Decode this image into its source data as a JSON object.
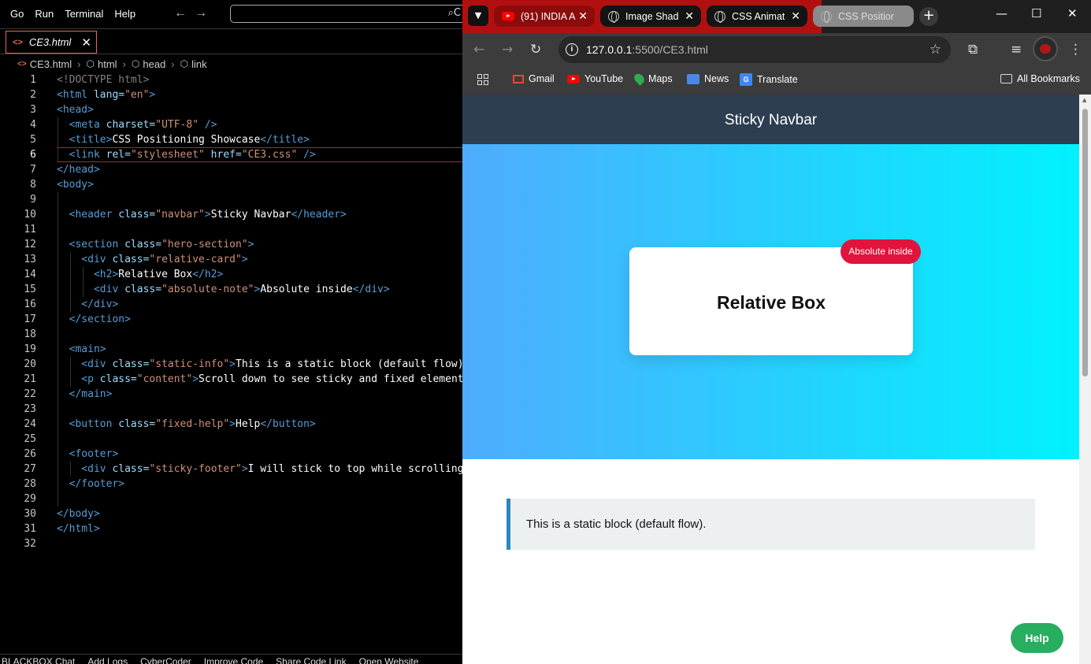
{
  "editor": {
    "menu": [
      "Go",
      "Run",
      "Terminal",
      "Help"
    ],
    "command_center_text": "C",
    "tab": {
      "name": "CE3.html",
      "icon": "html-file-icon"
    },
    "breadcrumb": [
      "CE3.html",
      "html",
      "head",
      "link"
    ],
    "current_line": 6,
    "lines": [
      "1",
      "2",
      "3",
      "4",
      "5",
      "6",
      "7",
      "8",
      "9",
      "10",
      "11",
      "12",
      "13",
      "14",
      "15",
      "16",
      "17",
      "18",
      "19",
      "20",
      "21",
      "22",
      "23",
      "24",
      "25",
      "26",
      "27",
      "28",
      "29",
      "30",
      "31",
      "32"
    ],
    "code": {
      "l1": "<!DOCTYPE html>",
      "l2a": "<html",
      "l2b": " lang=",
      "l2c": "\"en\"",
      "l2d": ">",
      "l3": "<head>",
      "l4a": "  <meta",
      "l4b": " charset=",
      "l4c": "\"UTF-8\"",
      "l4d": " />",
      "l5a": "  <title>",
      "l5b": "CSS Positioning Showcase",
      "l5c": "</title>",
      "l6a": "  <link",
      "l6b": " rel=",
      "l6c": "\"stylesheet\"",
      "l6d": " href=",
      "l6e": "\"CE3.css\"",
      "l6f": " />",
      "l7": "</head>",
      "l8": "<body>",
      "l10a": "  <header",
      "l10b": " class=",
      "l10c": "\"navbar\"",
      "l10d": ">",
      "l10e": "Sticky Navbar",
      "l10f": "</header>",
      "l12a": "  <section",
      "l12b": " class=",
      "l12c": "\"hero-section\"",
      "l12d": ">",
      "l13a": "    <div",
      "l13b": " class=",
      "l13c": "\"relative-card\"",
      "l13d": ">",
      "l14a": "      <h2>",
      "l14b": "Relative Box",
      "l14c": "</h2>",
      "l15a": "      <div",
      "l15b": " class=",
      "l15c": "\"absolute-note\"",
      "l15d": ">",
      "l15e": "Absolute inside",
      "l15f": "</div>",
      "l16": "    </div>",
      "l17": "  </section>",
      "l19": "  <main>",
      "l20a": "    <div",
      "l20b": " class=",
      "l20c": "\"static-info\"",
      "l20d": ">",
      "l20e": "This is a static block (default flow).",
      "l21a": "    <p",
      "l21b": " class=",
      "l21c": "\"content\"",
      "l21d": ">",
      "l21e": "Scroll down to see sticky and fixed elements",
      "l22": "  </main>",
      "l24a": "  <button",
      "l24b": " class=",
      "l24c": "\"fixed-help\"",
      "l24d": ">",
      "l24e": "Help",
      "l24f": "</button>",
      "l26": "  <footer>",
      "l27a": "    <div",
      "l27b": " class=",
      "l27c": "\"sticky-footer\"",
      "l27d": ">",
      "l27e": "I will stick to top while scrolling",
      "l28": "  </footer>",
      "l30": "</body>",
      "l31": "</html>"
    },
    "status_items": [
      "BLACKBOX Chat",
      "Add Logs",
      "CyberCoder",
      "Improve Code",
      "Share Code Link",
      "Open Website"
    ]
  },
  "browser": {
    "tabs": [
      {
        "title": "(91) INDIA A",
        "icon": "youtube-icon"
      },
      {
        "title": "Image Shad",
        "icon": "globe-icon"
      },
      {
        "title": "CSS Animat",
        "icon": "globe-icon"
      },
      {
        "title": "CSS Positior",
        "icon": "globe-icon",
        "active": true
      }
    ],
    "url_host": "127.0.0.1",
    "url_rest": ":5500/CE3.html",
    "bookmarks": [
      "Gmail",
      "YouTube",
      "Maps",
      "News",
      "Translate"
    ],
    "all_bookmarks": "All Bookmarks"
  },
  "page": {
    "navbar": "Sticky Navbar",
    "card_title": "Relative Box",
    "absolute_note": "Absolute inside",
    "static_info": "This is a static block (default flow).",
    "help_button": "Help",
    "colors": {
      "navbar": "#2c3e50",
      "hero_from": "#4facfe",
      "hero_to": "#00f2fe",
      "note": "#e0143c",
      "help": "#27ae60",
      "static_border": "#2e86c1"
    }
  }
}
